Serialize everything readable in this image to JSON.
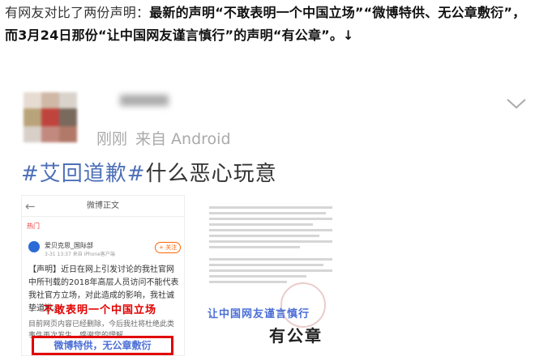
{
  "intro": {
    "prefix": "有网友对比了两份声明：",
    "bold": "最新的声明“不敢表明一个中国立场”“微博特供、无公章敷衍”，而3月24日那份“让中国网友谨言慎行”的声明“有公章”。↓"
  },
  "post": {
    "meta_time": "刚刚",
    "meta_source": "来自 Android",
    "hashtag": "#艾回道歉#",
    "text": "什么恶心玩意",
    "chevron_icon": "chevron-down-icon"
  },
  "image_left": {
    "nav_title": "微博正文",
    "hot": "热门",
    "account_name": "爱贝克思_国际部",
    "account_time": "3-31 13:37 来自 iPhone客户端",
    "follow": "+ 关注",
    "body_text": "【声明】近日在网上引发讨论的我社官网中所刊载的2018年高层人员访问不能代表我社官方立场，对此造成的影响，我社诚挚道歉。",
    "red_caption": "不敢表明一个中国立场",
    "body_text_2": "目前网页内容已经删除，今后我社将杜绝此类事件再次发生，感谢您的理解。",
    "box_caption": "微博特供，无公章敷衍"
  },
  "image_right": {
    "caption_1": "让中国网友谨言慎行",
    "caption_2": "有公章"
  }
}
